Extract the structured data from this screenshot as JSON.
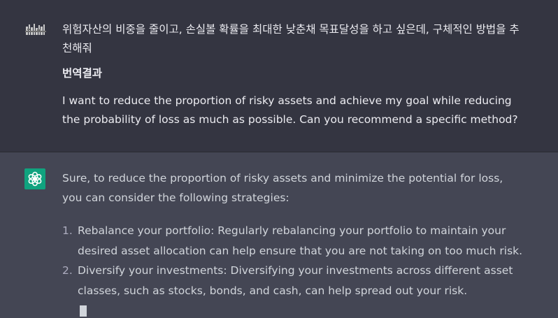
{
  "user_message": {
    "korean_text": "위험자산의 비중을 줄이고, 손실볼 확률을 최대한 낮춘채 목표달성을 하고 싶은데, 구체적인 방법을 추천해줘",
    "translation_heading": "번역결과",
    "translation_text": "I want to reduce the proportion of risky assets and achieve my goal while reducing the probability of loss as much as possible. Can you recommend a specific method?"
  },
  "assistant_message": {
    "intro": "Sure, to reduce the proportion of risky assets and minimize the potential for loss, you can consider the following strategies:",
    "items": [
      {
        "number": "1.",
        "text": "Rebalance your portfolio: Regularly rebalancing your portfolio to maintain your desired asset allocation can help ensure that you are not taking on too much risk."
      },
      {
        "number": "2.",
        "text": "Diversify your investments: Diversifying your investments across different asset classes, such as stocks, bonds, and cash, can help spread out your risk."
      }
    ]
  },
  "colors": {
    "user_bg": "#343541",
    "assistant_bg": "#444654",
    "gpt_avatar": "#10a37f"
  },
  "icons": {
    "user_avatar": "user-avatar-icon",
    "gpt_avatar": "openai-logo-icon"
  }
}
